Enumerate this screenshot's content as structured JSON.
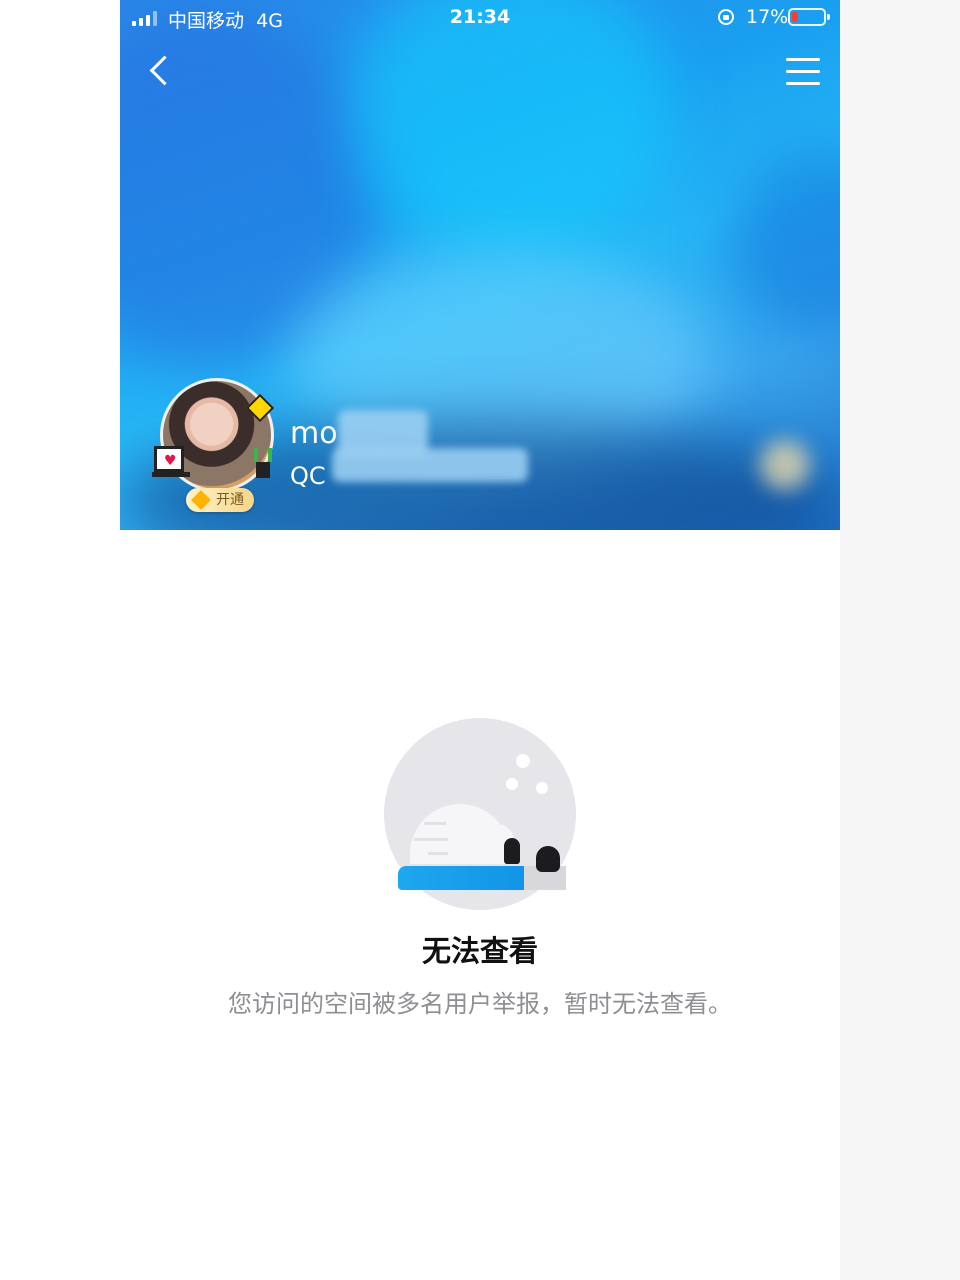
{
  "status_bar": {
    "carrier": "中国移动",
    "network": "4G",
    "time": "21:34",
    "battery_percent": "17%",
    "battery_level_color": "#ff3b30"
  },
  "nav": {
    "back_icon": "chevron-left-icon",
    "menu_icon": "hamburger-menu-icon"
  },
  "profile": {
    "name": "mo",
    "qq_prefix": "QC",
    "vip_badge_label": "开通"
  },
  "empty_state": {
    "title": "无法查看",
    "description": "您访问的空间被多名用户举报，暂时无法查看。",
    "illustration_icon": "moon-igloo-penguin-icon",
    "accent_color": "#1fa7ee"
  }
}
